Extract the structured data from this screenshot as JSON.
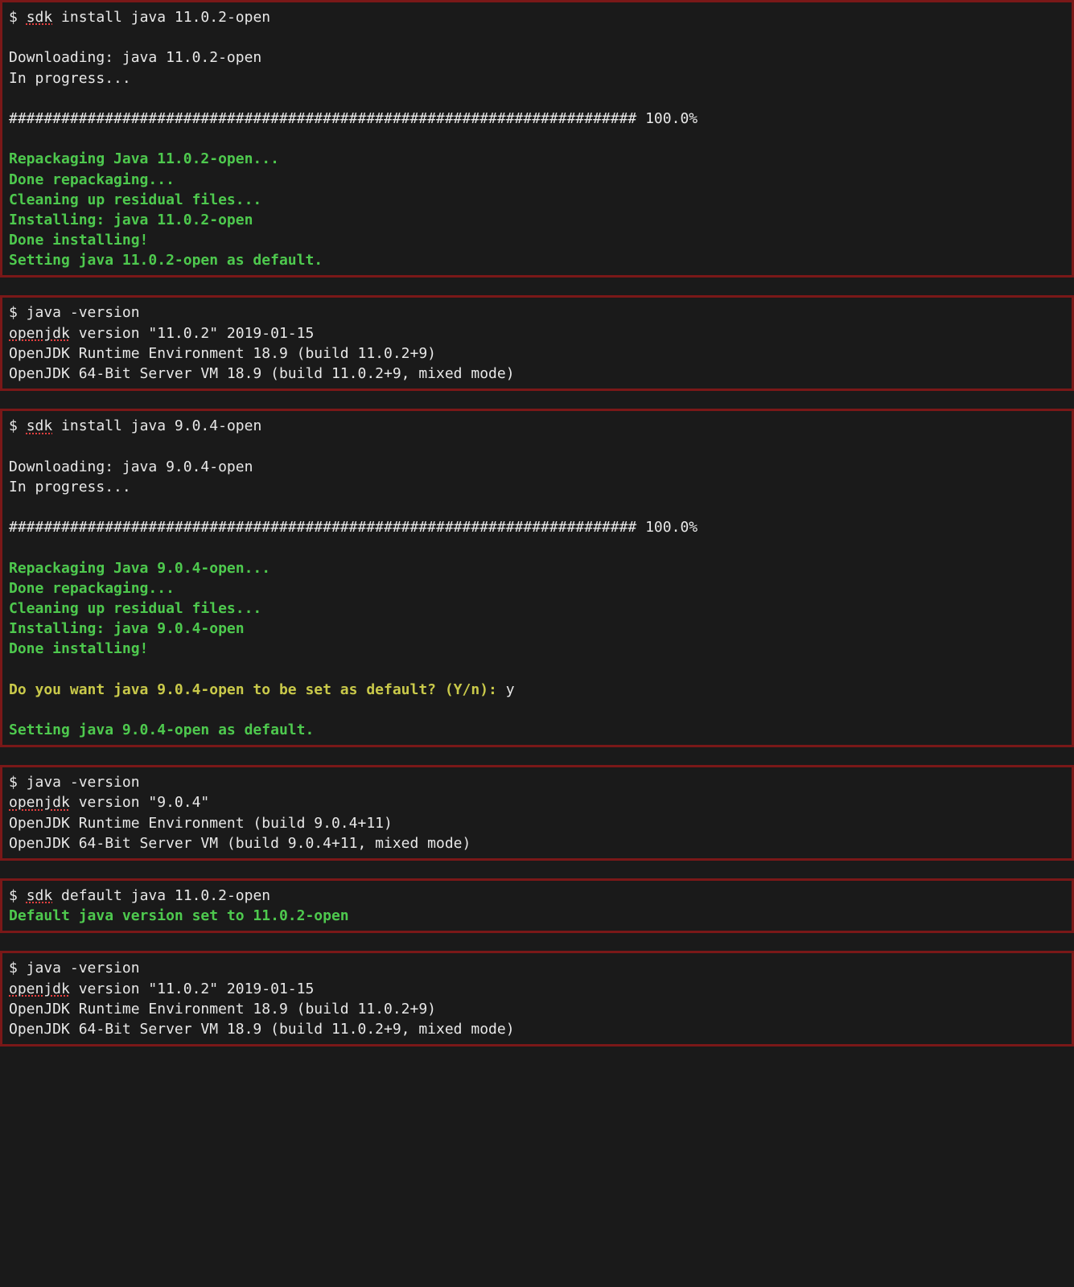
{
  "blocks": [
    {
      "lines": [
        {
          "segments": [
            {
              "text": "$ ",
              "cls": "white"
            },
            {
              "text": "sdk",
              "cls": "white spellcheck"
            },
            {
              "text": " install java 11.0.2-open",
              "cls": "white"
            }
          ]
        },
        {
          "segments": [
            {
              "text": " ",
              "cls": "white"
            }
          ]
        },
        {
          "segments": [
            {
              "text": "Downloading: java 11.0.2-open",
              "cls": "white"
            }
          ]
        },
        {
          "segments": [
            {
              "text": "In progress...",
              "cls": "white"
            }
          ]
        },
        {
          "segments": [
            {
              "text": " ",
              "cls": "white"
            }
          ]
        },
        {
          "segments": [
            {
              "text": "######################################################################## 100.0%",
              "cls": "white"
            }
          ]
        },
        {
          "segments": [
            {
              "text": " ",
              "cls": "white"
            }
          ]
        },
        {
          "segments": [
            {
              "text": "Repackaging Java 11.0.2-open...",
              "cls": "green"
            }
          ]
        },
        {
          "segments": [
            {
              "text": "Done repackaging...",
              "cls": "green"
            }
          ]
        },
        {
          "segments": [
            {
              "text": "Cleaning up residual files...",
              "cls": "green"
            }
          ]
        },
        {
          "segments": [
            {
              "text": "Installing: java 11.0.2-open",
              "cls": "green"
            }
          ]
        },
        {
          "segments": [
            {
              "text": "Done installing!",
              "cls": "green"
            }
          ]
        },
        {
          "segments": [
            {
              "text": "Setting java 11.0.2-open as default.",
              "cls": "green"
            }
          ]
        }
      ]
    },
    {
      "lines": [
        {
          "segments": [
            {
              "text": "$ java -version",
              "cls": "white"
            }
          ]
        },
        {
          "segments": [
            {
              "text": "openjdk",
              "cls": "white spellcheck"
            },
            {
              "text": " version \"11.0.2\" 2019-01-15",
              "cls": "white"
            }
          ]
        },
        {
          "segments": [
            {
              "text": "OpenJDK Runtime Environment 18.9 (build 11.0.2+9)",
              "cls": "white"
            }
          ]
        },
        {
          "segments": [
            {
              "text": "OpenJDK 64-Bit Server VM 18.9 (build 11.0.2+9, mixed mode)",
              "cls": "white"
            }
          ]
        }
      ]
    },
    {
      "lines": [
        {
          "segments": [
            {
              "text": "$ ",
              "cls": "white"
            },
            {
              "text": "sdk",
              "cls": "white spellcheck"
            },
            {
              "text": " install java 9.0.4-open",
              "cls": "white"
            }
          ]
        },
        {
          "segments": [
            {
              "text": " ",
              "cls": "white"
            }
          ]
        },
        {
          "segments": [
            {
              "text": "Downloading: java 9.0.4-open",
              "cls": "white"
            }
          ]
        },
        {
          "segments": [
            {
              "text": "In progress...",
              "cls": "white"
            }
          ]
        },
        {
          "segments": [
            {
              "text": " ",
              "cls": "white"
            }
          ]
        },
        {
          "segments": [
            {
              "text": "######################################################################## 100.0%",
              "cls": "white"
            }
          ]
        },
        {
          "segments": [
            {
              "text": " ",
              "cls": "white"
            }
          ]
        },
        {
          "segments": [
            {
              "text": "Repackaging Java 9.0.4-open...",
              "cls": "green"
            }
          ]
        },
        {
          "segments": [
            {
              "text": "Done repackaging...",
              "cls": "green"
            }
          ]
        },
        {
          "segments": [
            {
              "text": "Cleaning up residual files...",
              "cls": "green"
            }
          ]
        },
        {
          "segments": [
            {
              "text": "Installing: java 9.0.4-open",
              "cls": "green"
            }
          ]
        },
        {
          "segments": [
            {
              "text": "Done installing!",
              "cls": "green"
            }
          ]
        },
        {
          "segments": [
            {
              "text": " ",
              "cls": "white"
            }
          ]
        },
        {
          "segments": [
            {
              "text": "Do you want java 9.0.4-open to be set as default? (Y/n): ",
              "cls": "yellow"
            },
            {
              "text": "y",
              "cls": "white"
            }
          ]
        },
        {
          "segments": [
            {
              "text": " ",
              "cls": "white"
            }
          ]
        },
        {
          "segments": [
            {
              "text": "Setting java 9.0.4-open as default.",
              "cls": "green"
            }
          ]
        }
      ]
    },
    {
      "lines": [
        {
          "segments": [
            {
              "text": "$ java -version",
              "cls": "white"
            }
          ]
        },
        {
          "segments": [
            {
              "text": "openjdk",
              "cls": "white spellcheck"
            },
            {
              "text": " version \"9.0.4\"",
              "cls": "white"
            }
          ]
        },
        {
          "segments": [
            {
              "text": "OpenJDK Runtime Environment (build 9.0.4+11)",
              "cls": "white"
            }
          ]
        },
        {
          "segments": [
            {
              "text": "OpenJDK 64-Bit Server VM (build 9.0.4+11, mixed mode)",
              "cls": "white"
            }
          ]
        }
      ]
    },
    {
      "lines": [
        {
          "segments": [
            {
              "text": "$ ",
              "cls": "white"
            },
            {
              "text": "sdk",
              "cls": "white spellcheck"
            },
            {
              "text": " default java 11.0.2-open",
              "cls": "white"
            }
          ]
        },
        {
          "segments": [
            {
              "text": "Default java version set to 11.0.2-open",
              "cls": "green"
            }
          ]
        }
      ]
    },
    {
      "lines": [
        {
          "segments": [
            {
              "text": "$ java -version",
              "cls": "white"
            }
          ]
        },
        {
          "segments": [
            {
              "text": "openjdk",
              "cls": "white spellcheck"
            },
            {
              "text": " version \"11.0.2\" 2019-01-15",
              "cls": "white"
            }
          ]
        },
        {
          "segments": [
            {
              "text": "OpenJDK Runtime Environment 18.9 (build 11.0.2+9)",
              "cls": "white"
            }
          ]
        },
        {
          "segments": [
            {
              "text": "OpenJDK 64-Bit Server VM 18.9 (build 11.0.2+9, mixed mode)",
              "cls": "white"
            }
          ]
        }
      ]
    }
  ]
}
